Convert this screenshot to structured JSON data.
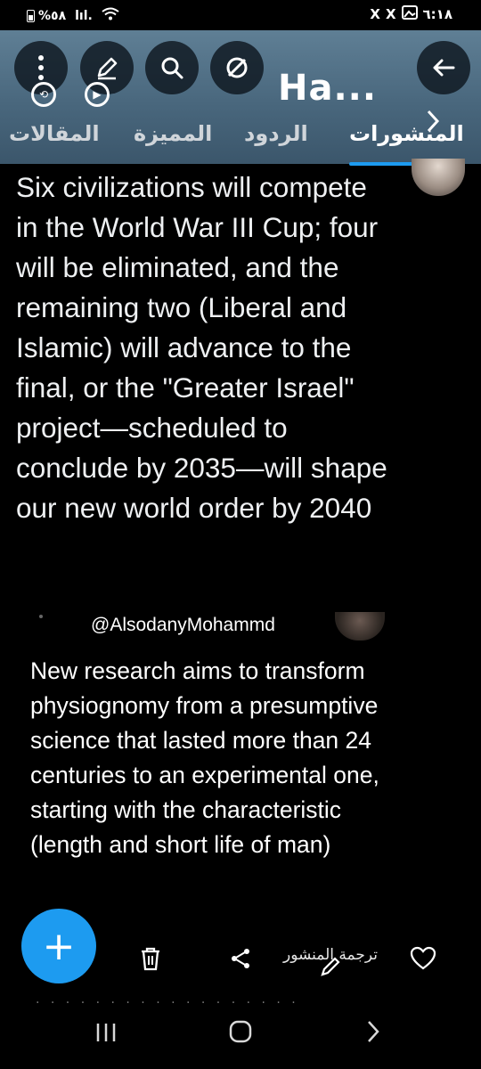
{
  "status_bar": {
    "battery": "%٥٨",
    "signal": "lıl.",
    "notifications": [
      "X",
      "X"
    ],
    "time": "٦:١٨"
  },
  "header": {
    "title": "Ha...",
    "icons": [
      "more-vertical-icon",
      "edit-icon",
      "search-icon",
      "mute-icon",
      "back-arrow-icon"
    ]
  },
  "tabs": {
    "items": [
      "المقالات",
      "المميزة",
      "الردود",
      "المنشورات"
    ],
    "active": "المنشورات"
  },
  "post": {
    "text": "Six civilizations will compete in the World War III Cup; four will be eliminated, and the remaining two (Liberal and Islamic) will advance to the final, or the \"Greater Israel\" project—scheduled to conclude by 2035—will shape our new world order by 2040"
  },
  "quote": {
    "handle": "@AlsodanyMohammd",
    "text": "New research aims to transform physiognomy from a presumptive science that lasted more than 24 centuries to an experimental one, starting with the characteristic (length and short life of man)"
  },
  "actions": {
    "translate": "ترجمة المنشور",
    "compose": "+"
  }
}
